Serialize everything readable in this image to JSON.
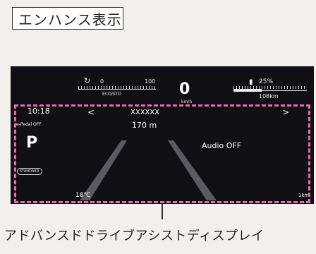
{
  "section_title": "エンハンス表示",
  "cluster": {
    "power_scale": {
      "min_label": "0",
      "max_label": "100",
      "under_label": "ECO/STD"
    },
    "speed": "0",
    "speed_unit": "km/h",
    "battery": {
      "percent": "25%",
      "range": "108km"
    },
    "time": "10:18",
    "epedal": "e-Pedal OFF",
    "gear": "P",
    "drive_mode": "STANDARD",
    "nav": {
      "street": "XXXXXX",
      "distance": "170 m"
    },
    "audio": "Audio OFF",
    "temperature": "18℃",
    "distance_scale": "1km"
  },
  "caption": "アドバンスドドライブアシストディスプレイ",
  "colors": {
    "highlight": "#e86aa8",
    "screen_bg": "#101014"
  },
  "icons": [
    "left-arrow-icon",
    "right-arrow-icon",
    "power-gauge-icon",
    "battery-icon"
  ]
}
